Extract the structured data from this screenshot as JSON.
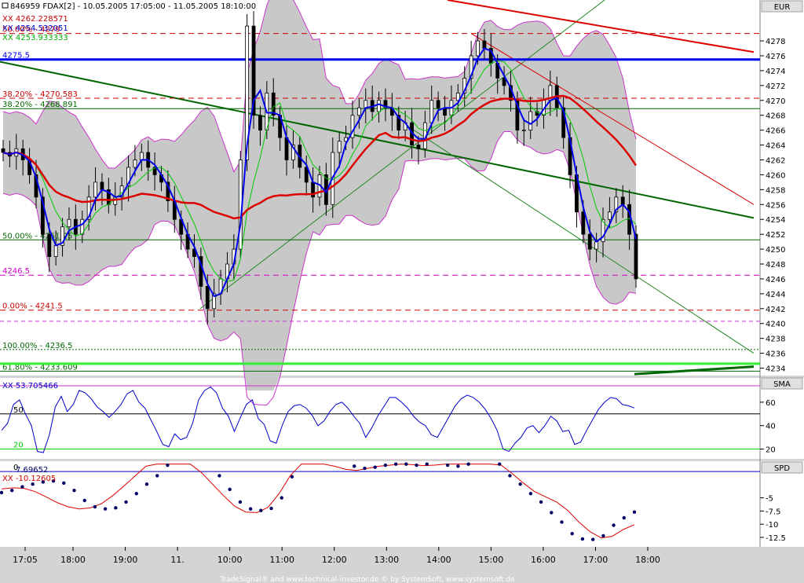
{
  "window": {
    "title_icon": "chart-window-icon",
    "title": "846959  FDAX[2] - 10.05.2005 17:05:00 - 11.05.2005 18:10:00",
    "footer": "TradeSignal® and www.technical-investor.de © by SystemSoft, www.systemsoft.de"
  },
  "chart_data": [
    {
      "panel": "price",
      "type": "candlestick",
      "axis_unit": "EUR",
      "ylim": [
        4233,
        4283.5
      ],
      "yticks": [
        4234,
        4236,
        4238,
        4240,
        4242,
        4244,
        4246,
        4248,
        4250,
        4252,
        4254,
        4256,
        4258,
        4260,
        4262,
        4264,
        4266,
        4268,
        4270,
        4272,
        4274,
        4276,
        4278
      ],
      "x_ticks": [
        "17:05",
        "18:00",
        "19:00",
        "11.",
        "10:00",
        "11:00",
        "12:00",
        "13:00",
        "14:00",
        "15:00",
        "16:00",
        "17:00",
        "18:00"
      ],
      "x_tick_minutes": [
        0,
        55,
        115,
        175,
        235,
        295,
        355,
        415,
        475,
        535,
        595,
        655,
        715
      ],
      "legend": [
        {
          "text": "XX 4262.228571",
          "color": "#cc0000"
        },
        {
          "text": "XX 4254.532051",
          "color": "#0000cc"
        },
        {
          "text": "XX 4253.933333",
          "color": "#00aa00"
        }
      ],
      "horizontal_levels": [
        {
          "label": "50.00% - 4279",
          "y": 4279,
          "color": "#cc0000",
          "style": "dashed"
        },
        {
          "label": "4275.5",
          "y": 4275.5,
          "color": "#0000ee",
          "style": "thick"
        },
        {
          "label": "38.20% - 4270.583",
          "y": 4270.3,
          "color": "#cc0000",
          "style": "dashed"
        },
        {
          "label": "38.20% - 4268.891",
          "y": 4268.9,
          "color": "#006600",
          "style": "solid"
        },
        {
          "label": "50.00% - 4251.25",
          "y": 4251.25,
          "color": "#006600",
          "style": "solid"
        },
        {
          "label": "4246.5",
          "y": 4246.5,
          "color": "#cc00cc",
          "style": "dashed"
        },
        {
          "label": "0.00% - 4241.5",
          "y": 4241.8,
          "color": "#cc0000",
          "style": "dashed"
        },
        {
          "label": "100.00% - 4236.5",
          "y": 4236.5,
          "color": "#006600",
          "style": "dotted"
        },
        {
          "label": "61.80% - 4233.609",
          "y": 4233.6,
          "color": "#006600",
          "style": "solid"
        }
      ],
      "close_values": [
        4263,
        4262.5,
        4263.5,
        4262,
        4260,
        4257,
        4252,
        4249,
        4250.5,
        4253,
        4254,
        4252,
        4254,
        4257,
        4259,
        4258,
        4256,
        4257,
        4258.5,
        4261,
        4262,
        4263,
        4261,
        4260,
        4259,
        4256.5,
        4254,
        4252,
        4250,
        4249,
        4245,
        4242,
        4244,
        4246,
        4248,
        4250,
        4262,
        4280,
        4268,
        4266,
        4271,
        4268,
        4265,
        4262,
        4264,
        4261,
        4259,
        4257,
        4260,
        4256,
        4263,
        4264.5,
        4265,
        4268,
        4269,
        4270,
        4268.5,
        4270,
        4269,
        4268,
        4266,
        4267,
        4264,
        4263.5,
        4267,
        4270,
        4269,
        4268,
        4270,
        4271,
        4273,
        4276,
        4278,
        4277,
        4275,
        4273,
        4272,
        4270,
        4266,
        4266,
        4268.5,
        4268,
        4270,
        4272,
        4269,
        4265,
        4260,
        4255,
        4252,
        4250,
        4251,
        4254,
        4255,
        4257,
        4256,
        4252,
        4246
      ]
    },
    {
      "panel": "SMA",
      "type": "line",
      "title": "SMA",
      "legend": [
        {
          "text": "XX 53.705466",
          "color": "#0000cc"
        }
      ],
      "ylim": [
        13,
        76
      ],
      "yticks": [
        20,
        40,
        60
      ],
      "reference_levels": [
        {
          "label": "50",
          "y": 50
        },
        {
          "label": "20",
          "y": 20
        }
      ],
      "values": [
        36,
        42,
        58,
        62,
        50,
        40,
        18,
        17,
        32,
        56,
        65,
        52,
        58,
        70,
        68,
        63,
        56,
        52,
        47,
        52,
        58,
        67,
        70,
        60,
        55,
        45,
        35,
        24,
        22,
        33,
        28,
        30,
        42,
        62,
        70,
        73,
        68,
        55,
        48,
        35,
        47,
        58,
        62,
        46,
        41,
        27,
        25,
        40,
        52,
        57,
        58,
        55,
        49,
        40,
        44,
        52,
        58,
        60,
        55,
        48,
        42,
        30,
        38,
        48,
        56,
        64,
        64,
        60,
        55,
        48,
        43,
        40,
        32,
        30,
        39,
        48,
        57,
        63,
        66,
        64,
        60,
        54,
        46,
        36,
        20,
        18,
        25,
        30,
        38,
        40,
        34,
        40,
        48,
        44,
        35,
        36,
        24,
        26,
        36,
        45,
        54,
        60,
        64,
        63,
        58,
        57,
        55
      ]
    },
    {
      "panel": "SPD",
      "type": "dot_and_line",
      "title": "SPD",
      "legend": [
        {
          "text": "7.69652",
          "color": "#000066"
        },
        {
          "text": "XX -10.12605",
          "color": "#cc0000"
        }
      ],
      "ylim": [
        -14,
        1.5
      ],
      "yticks": [
        -12.5,
        -10,
        -7.5,
        -5
      ],
      "reference_levels": [
        {
          "label": "0",
          "y": 0
        }
      ],
      "dot_values": [
        -4,
        -3.6,
        -2.9,
        -2.4,
        -2.0,
        -1.8,
        -2.2,
        -3.6,
        -5.5,
        -6.7,
        -7.1,
        -6.9,
        -5.8,
        -4.2,
        -2.4,
        -0.8,
        1.2,
        2.0,
        2.6,
        2.4,
        1.6,
        -0.8,
        -3.4,
        -5.8,
        -7.1,
        -7.4,
        -7.0,
        -5.0,
        -1.0,
        2.4,
        2.6,
        2.4,
        2.2,
        1.8,
        1.0,
        0.6,
        0.8,
        1.2,
        1.4,
        1.4,
        1.2,
        1.4,
        1.6,
        1.2,
        1.0,
        1.4,
        2.8,
        2.6,
        1.4,
        -0.8,
        -2.4,
        -4.2,
        -5.8,
        -7.8,
        -9.6,
        -11.8,
        -12.8,
        -12.9,
        -12.2,
        -10.2,
        -8.8,
        -7.7
      ],
      "line_values": [
        -3.3,
        -3.1,
        -3.2,
        -3.8,
        -4.8,
        -5.9,
        -6.7,
        -7.1,
        -6.9,
        -6.1,
        -4.6,
        -2.8,
        -0.9,
        1.0,
        2.6,
        3.2,
        3.0,
        1.8,
        -0.2,
        -2.4,
        -4.6,
        -6.6,
        -7.7,
        -7.8,
        -6.8,
        -4.2,
        -0.8,
        2.8,
        3.4,
        2.4,
        1.0,
        0.4,
        0.2,
        0.6,
        1.0,
        1.2,
        1.4,
        1.3,
        1.1,
        1.2,
        1.6,
        2.0,
        2.4,
        2.4,
        2.0,
        1.2,
        -0.4,
        -2.2,
        -3.8,
        -4.8,
        -5.8,
        -7.4,
        -9.6,
        -11.4,
        -12.6,
        -12.3,
        -11.0,
        -10.1
      ]
    }
  ]
}
